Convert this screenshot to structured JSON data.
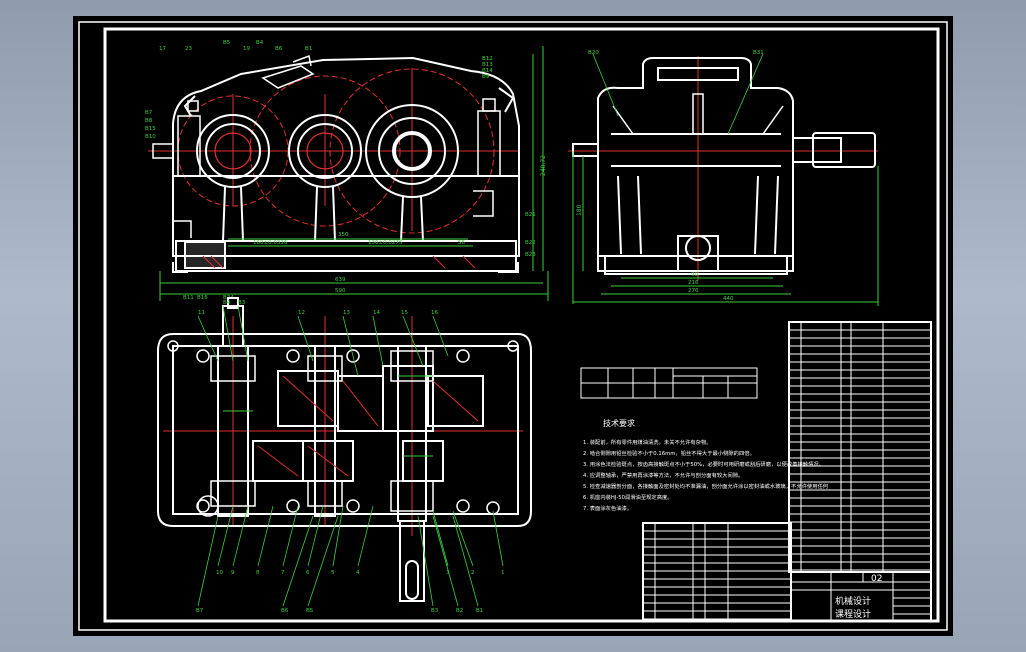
{
  "balloons_front": [
    "17",
    "23",
    "B5",
    "19",
    "B4",
    "B6",
    "B1",
    "B12",
    "B13",
    "B14",
    "B7",
    "B8",
    "B15",
    "B9",
    "B10",
    "B11",
    "B16",
    "B21",
    "B22",
    "B23",
    "B24"
  ],
  "balloons_side": [
    "B20",
    "B31"
  ],
  "balloons_plan_top": [
    "11",
    "B4",
    "B3",
    "12",
    "13",
    "14",
    "15",
    "16"
  ],
  "balloons_plan_bottom": [
    "10",
    "9",
    "8",
    "7",
    "6",
    "5",
    "4",
    "3",
    "2",
    "1",
    "B7",
    "B6",
    "B5",
    "B3",
    "B2",
    "B1"
  ],
  "dims_front": {
    "height": "240.72",
    "d1": "350",
    "d2": "160±0.0316",
    "d3": "130±0.0275",
    "d4": "56",
    "total": "639",
    "d5": "590"
  },
  "dims_side": {
    "height": "180",
    "d1": "90",
    "d2": "216",
    "d3": "276",
    "d4": "440"
  },
  "spec_table": {
    "rows": [
      [
        "",
        "",
        "",
        "",
        "",
        ""
      ],
      [
        "",
        "",
        "",
        "",
        "",
        ""
      ]
    ]
  },
  "notes": {
    "title": "技术要求",
    "items": [
      "1. 装配前，所有零件用煤油清洗，未关不允许有杂物。",
      "2. 啮合侧隙用铅丝检验不小于0.16mm，铅丝不得大于最小侧隙的四倍。",
      "3. 用涂色法检验斑点，按齿高接触斑点不小于50%，必要时可用研磨或刮后研磨，以便改善接触情况。",
      "4. 应调整轴承，严禁用再涂漆等方法，不允许与剖分面有较大间隙。",
      "5. 检查减速器剖分面，各接触面及密封处均不准漏油，剖分面允许涂以密封油或水玻璃，不允许使用任何填料。",
      "6. 机座内装HJ-50润滑油至规定高度。",
      "7. 表面涂灰色油漆。"
    ]
  },
  "title_block": {
    "drawing_no": "02",
    "title_line1": "机械设计",
    "title_line2": "课程设计"
  }
}
